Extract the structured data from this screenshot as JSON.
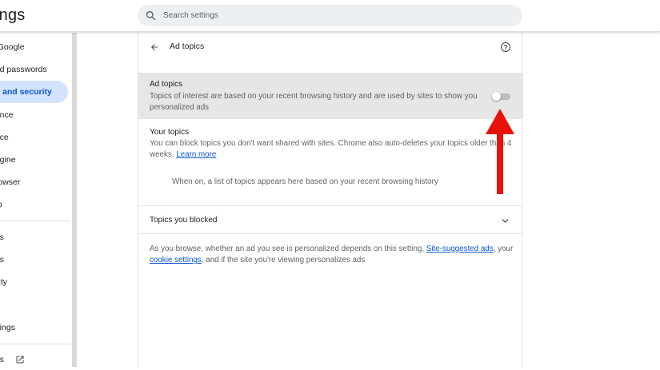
{
  "header": {
    "title": "ings",
    "search_placeholder": "Search settings"
  },
  "sidebar": {
    "items": [
      {
        "label": "d Google"
      },
      {
        "label": "and passwords"
      },
      {
        "label": "and security",
        "active": true
      },
      {
        "label": "nance"
      },
      {
        "label": "ance"
      },
      {
        "label": "engine"
      },
      {
        "label": "browser"
      },
      {
        "label": "tup"
      },
      {
        "label": "ges"
      },
      {
        "label": "ads"
      },
      {
        "label": "bility"
      },
      {
        "label": "ettings"
      },
      {
        "label": "ons"
      }
    ]
  },
  "page": {
    "title": "Ad topics",
    "toggle": {
      "title": "Ad topics",
      "description": "Topics of interest are based on your recent browsing history and are used by sites to show you personalized ads",
      "enabled": false
    },
    "your_topics": {
      "title": "Your topics",
      "description": "You can block topics you don't want shared with sites. Chrome also auto-deletes your topics older than 4 weeks.",
      "learn_more": "Learn more",
      "empty_state": "When on, a list of topics appears here based on your recent browsing history"
    },
    "blocked": {
      "label": "Topics you blocked"
    },
    "footer": {
      "prefix": "As you browse, whether an ad you see is personalized depends on this setting, ",
      "link1": "Site-suggested ads",
      "middle": ", your ",
      "link2": "cookie settings",
      "suffix": ", and if the site you're viewing personalizes ads"
    }
  },
  "colors": {
    "accent": "#0b57d0",
    "active_nav_bg": "#d3e3fd",
    "toggle_row_bg": "#e6e6e6",
    "annotation_arrow": "#e8120c"
  },
  "icons": {
    "search": "search-icon",
    "back": "back-arrow-icon",
    "help": "help-circle-icon",
    "chevron": "chevron-down-icon",
    "external": "external-link-icon"
  }
}
